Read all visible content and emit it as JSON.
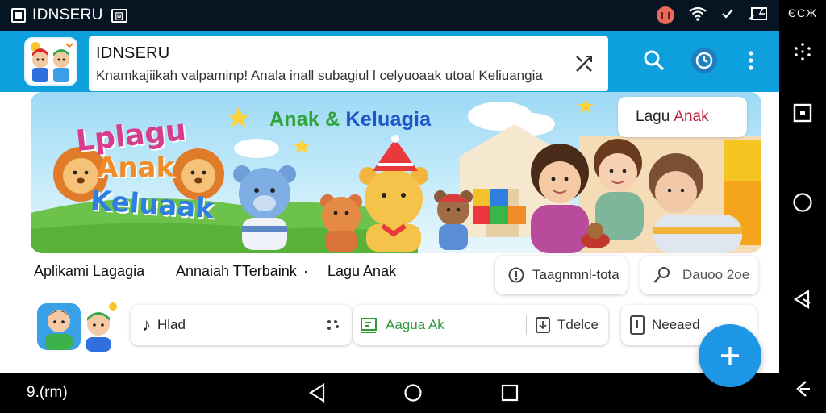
{
  "status_bar": {
    "app_title": "IDNSERU",
    "badge": "回"
  },
  "app_bar": {
    "title": "IDNSERU",
    "subtitle": "Knamkajiikah valpaminp! Anala inall subagiul l celyuoaak utoal Keliuangia"
  },
  "banner": {
    "heading_part1": "Anak & ",
    "heading_part2": "Keluagia",
    "tag_part1": "Lagu",
    "tag_part2": "Anak",
    "logo_line1": "Lplagu",
    "logo_line2": "Anak",
    "logo_line3": "Keluaak"
  },
  "labels": [
    "Aplikami Lagagia",
    "Annaiah TTerbaink",
    "·",
    "Lagu Anak"
  ],
  "pills": {
    "pill1": "Taagnmnl-tota",
    "pill2": "Dauoo 2oe"
  },
  "row2": {
    "item1": "Hlad",
    "item2": "Aagua Ak",
    "item3": "Tdelce",
    "item4": "Neeaed"
  },
  "bottom_nav": {
    "time": "9.(rm)"
  },
  "side_nav": {
    "top_label": "ЄСЖ"
  },
  "colors": {
    "app_bar": "#0ea0dc",
    "status_bar": "#071422",
    "fab": "#1e96e6",
    "heading_green": "#31a33c",
    "heading_blue": "#1d56c8"
  }
}
